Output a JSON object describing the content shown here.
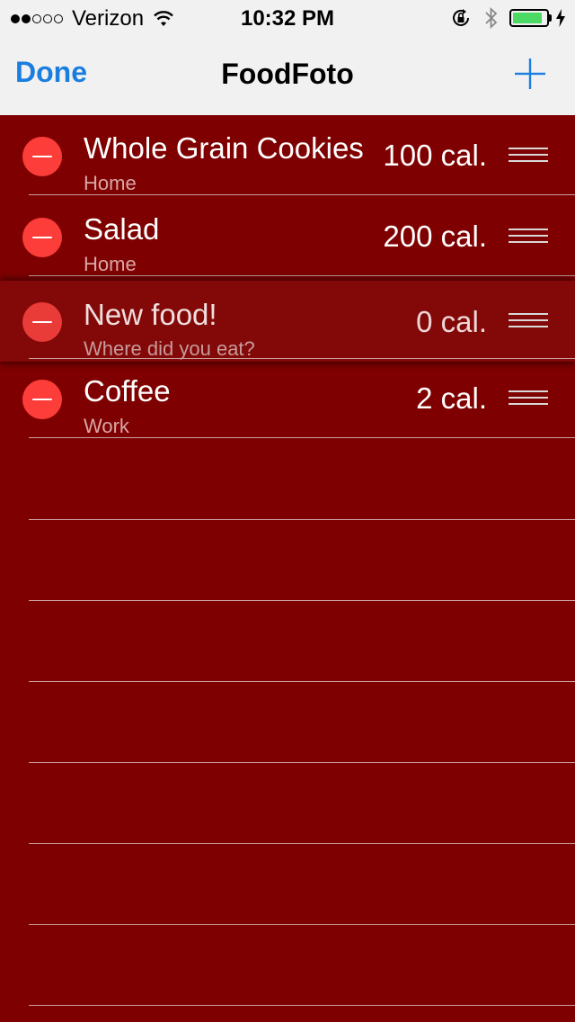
{
  "status_bar": {
    "signal_bars_filled": 2,
    "signal_bars_total": 5,
    "carrier": "Verizon",
    "time": "10:32 PM",
    "battery_level": 0.9,
    "battery_color": "#4cd964"
  },
  "nav": {
    "done_label": "Done",
    "title": "FoodFoto",
    "add_icon": "plus-icon",
    "accent_color": "#1a7ee0"
  },
  "foods": [
    {
      "name": "Whole Grain Cookies",
      "place": "Home",
      "calories": "100 cal."
    },
    {
      "name": "Salad",
      "place": "Home",
      "calories": "200 cal."
    },
    {
      "name": "New food!",
      "place": "Where did you eat?",
      "calories": "0 cal.",
      "state": "dragging"
    },
    {
      "name": "Coffee",
      "place": "Work",
      "calories": "2 cal."
    }
  ],
  "theme": {
    "background": "#7f0000",
    "delete_color": "#fc3d39"
  }
}
